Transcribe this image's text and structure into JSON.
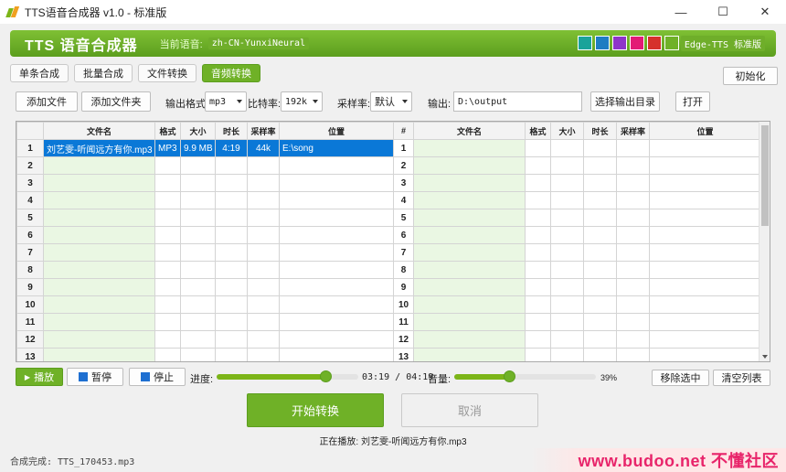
{
  "window": {
    "title": "TTS语音合成器 v1.0 - 标准版",
    "minimize": "—",
    "maximize": "☐",
    "close": "✕"
  },
  "banner": {
    "app_name": "TTS  语音合成器",
    "voice_label": "当前语音:",
    "voice_value": "zh-CN-YunxiNeural",
    "theme_colors": [
      "#1aa39a",
      "#1f7dc2",
      "#8e35c9",
      "#e31a75",
      "#d6302b",
      "#6fb127"
    ],
    "engine": "Edge-TTS 标准版"
  },
  "tabs": [
    "单条合成",
    "批量合成",
    "文件转换",
    "音频转换"
  ],
  "active_tab": "音频转换",
  "init_button": "初始化",
  "toolbar": {
    "add_file": "添加文件",
    "add_folder": "添加文件夹",
    "format_label": "输出格式:",
    "format_value": "mp3",
    "bitrate_label": "比特率:",
    "bitrate_value": "192k",
    "samplerate_label": "采样率:",
    "samplerate_value": "默认",
    "output_label": "输出:",
    "output_value": "D:\\output",
    "choose_output": "选择输出目录",
    "open": "打开"
  },
  "table": {
    "columns": [
      "文件名",
      "格式",
      "大小",
      "时长",
      "采样率",
      "位置"
    ],
    "right_index_header": "#",
    "rows": [
      {
        "num": "1",
        "name": "刘艺雯-听闻远方有你.mp3",
        "format": "MP3",
        "size": "9.9 MB",
        "duration": "4:19",
        "rate": "44k",
        "location": "E:\\song"
      },
      {
        "num": "2"
      },
      {
        "num": "3"
      },
      {
        "num": "4"
      },
      {
        "num": "5"
      },
      {
        "num": "6"
      },
      {
        "num": "7"
      },
      {
        "num": "8"
      },
      {
        "num": "9"
      },
      {
        "num": "10"
      },
      {
        "num": "11"
      },
      {
        "num": "12"
      },
      {
        "num": "13"
      }
    ]
  },
  "playback": {
    "play": "播放",
    "pause": "暂停",
    "stop": "停止",
    "progress_label": "进度:",
    "position": "03:19",
    "separator": "/",
    "total": "04:19",
    "progress_fraction": 0.77,
    "volume_label": "音量:",
    "volume_text": "39%",
    "volume_fraction": 0.39,
    "remove_selected": "移除选中",
    "clear_list": "清空列表"
  },
  "actions": {
    "start": "开始转换",
    "cancel": "取消"
  },
  "now_playing": "正在播放: 刘艺雯-听闻远方有你.mp3",
  "status": "合成完成: TTS_170453.mp3",
  "watermark": "www.budoo.net 不懂社区"
}
